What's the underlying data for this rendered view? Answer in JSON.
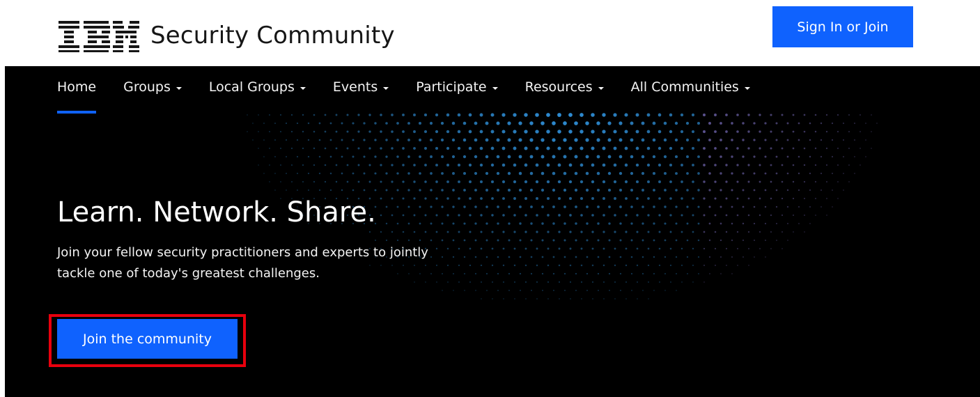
{
  "header": {
    "logo_text": "IBM",
    "site_title": "Security Community",
    "signin_label": "Sign In or Join"
  },
  "nav": {
    "items": [
      {
        "label": "Home",
        "active": true,
        "dropdown": false
      },
      {
        "label": "Groups",
        "active": false,
        "dropdown": true
      },
      {
        "label": "Local Groups",
        "active": false,
        "dropdown": true
      },
      {
        "label": "Events",
        "active": false,
        "dropdown": true
      },
      {
        "label": "Participate",
        "active": false,
        "dropdown": true
      },
      {
        "label": "Resources",
        "active": false,
        "dropdown": true
      },
      {
        "label": "All Communities",
        "active": false,
        "dropdown": true
      }
    ]
  },
  "hero": {
    "title": "Learn. Network. Share.",
    "description": "Join your fellow security practitioners and experts to jointly tackle one of today's greatest challenges.",
    "cta_label": "Join the community"
  },
  "colors": {
    "accent": "#0f62fe",
    "hero_background": "#000000",
    "highlight_outline": "#e8000d"
  }
}
